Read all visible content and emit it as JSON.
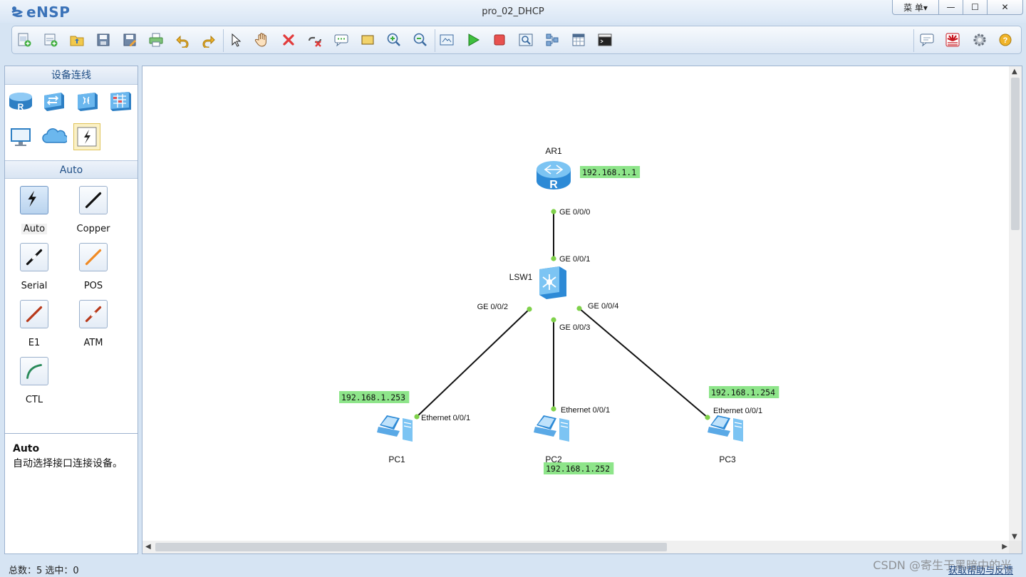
{
  "app": {
    "name": "eNSP",
    "window_title": "pro_02_DHCP"
  },
  "window_controls": {
    "menu_label": "菜 单▾",
    "minimize": "—",
    "maximize": "☐",
    "close": "✕"
  },
  "toolbar": {
    "buttons": [
      "new-topology",
      "new-lab",
      "open",
      "save",
      "save-as",
      "print",
      "undo",
      "redo",
      "select",
      "pan",
      "delete",
      "delete-link",
      "text-note",
      "rectangle",
      "zoom-in",
      "zoom-out",
      "fit",
      "start-device",
      "stop-device",
      "capture",
      "topology",
      "grid",
      "console"
    ],
    "right_buttons": [
      "feedback",
      "huawei-logo",
      "settings",
      "help"
    ]
  },
  "left_panel": {
    "device_header": "设备连线",
    "device_icons": [
      "router",
      "switch",
      "wlan",
      "firewall",
      "pc",
      "cloud",
      "connections"
    ],
    "links_header": "Auto",
    "links": [
      {
        "label": "Auto",
        "color": "#1f4e86"
      },
      {
        "label": "Copper",
        "color": "#111111"
      },
      {
        "label": "Serial",
        "color": "#111111"
      },
      {
        "label": "POS",
        "color": "#f08a24"
      },
      {
        "label": "E1",
        "color": "#b8391a"
      },
      {
        "label": "ATM",
        "color": "#b8391a"
      },
      {
        "label": "CTL",
        "color": "#2a8a5a"
      }
    ]
  },
  "description": {
    "title": "Auto",
    "text": "自动选择接口连接设备。"
  },
  "topology": {
    "nodes": [
      {
        "id": "AR1",
        "label": "AR1",
        "type": "router",
        "ip": "192.168.1.1"
      },
      {
        "id": "LSW1",
        "label": "LSW1",
        "type": "switch"
      },
      {
        "id": "PC1",
        "label": "PC1",
        "type": "pc",
        "ip": "192.168.1.253"
      },
      {
        "id": "PC2",
        "label": "PC2",
        "type": "pc",
        "ip": "192.168.1.252"
      },
      {
        "id": "PC3",
        "label": "PC3",
        "type": "pc",
        "ip": "192.168.1.254"
      }
    ],
    "links": [
      {
        "from": "AR1",
        "to": "LSW1",
        "from_port": "GE 0/0/0",
        "to_port": "GE 0/0/1"
      },
      {
        "from": "LSW1",
        "to": "PC1",
        "from_port": "GE 0/0/2",
        "to_port": "Ethernet 0/0/1"
      },
      {
        "from": "LSW1",
        "to": "PC2",
        "from_port": "GE 0/0/3",
        "to_port": "Ethernet 0/0/1"
      },
      {
        "from": "LSW1",
        "to": "PC3",
        "from_port": "GE 0/0/4",
        "to_port": "Ethernet 0/0/1"
      }
    ],
    "colors": {
      "ip_bg": "#8ee58a",
      "port_dot": "#7fd14a",
      "link": "#111111",
      "device": "#3a9ee6"
    }
  },
  "status": {
    "text": "总数：5  选中：0",
    "link": "获取帮助与反馈"
  },
  "watermark": "CSDN @寄生于黑暗中的光"
}
